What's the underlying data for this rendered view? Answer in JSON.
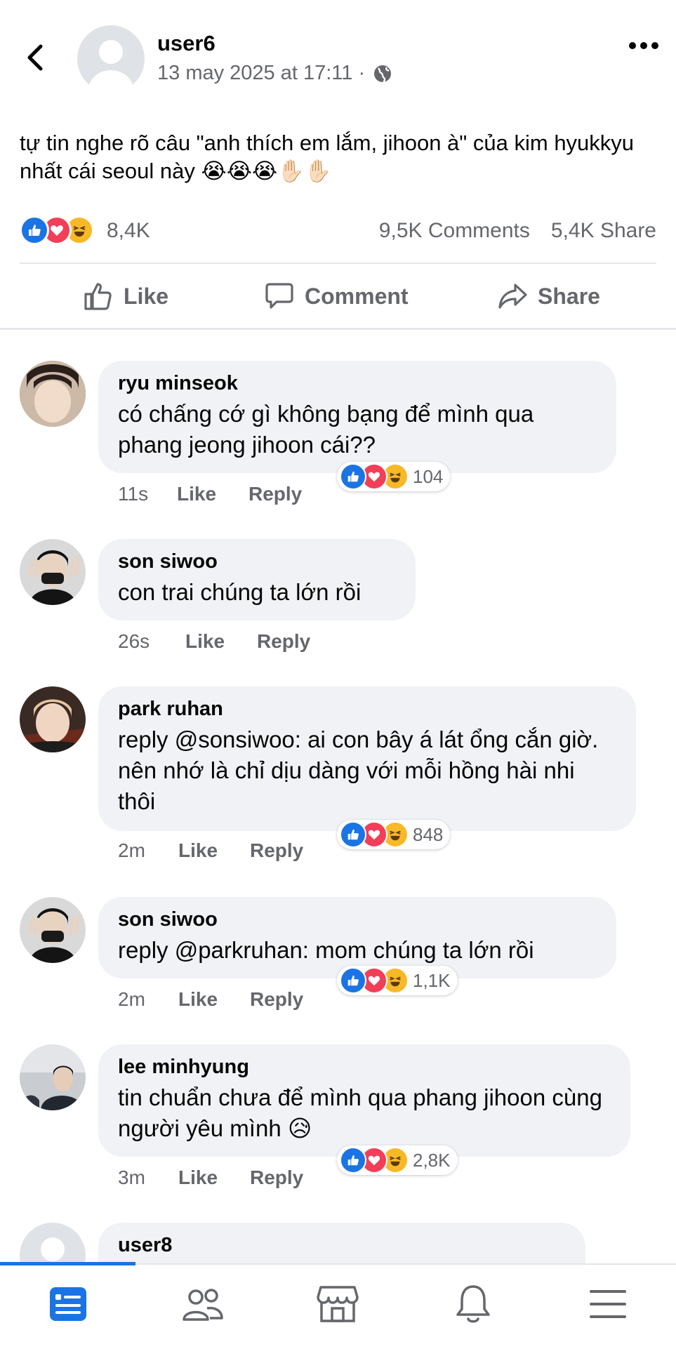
{
  "post": {
    "author": "user6",
    "timestamp": "13 may 2025 at 17:11 ·",
    "text": "tự tin nghe rõ câu \"anh thích em lắm, jihoon à\" của kim hyukkyu nhất cái seoul này 😭😭😭✋🏻✋🏻",
    "reaction_count": "8,4K",
    "comments_count": "9,5K Comments",
    "shares_count": "5,4K Share"
  },
  "actions": {
    "like": "Like",
    "comment": "Comment",
    "share": "Share"
  },
  "comments": [
    {
      "author": "ryu minseok",
      "text": "có chấng cớ gì không bạng để mình qua phang jeong jihoon cái??",
      "time": "11s",
      "like": "Like",
      "reply": "Reply",
      "reactions": "104"
    },
    {
      "author": "son siwoo",
      "text": "con trai chúng ta lớn rồi",
      "time": "26s",
      "like": "Like",
      "reply": "Reply"
    },
    {
      "author": "park ruhan",
      "text": "reply @sonsiwoo: ai con bây á lát ổng cắn giờ. nên nhớ là chỉ dịu dàng với mỗi hồng hài nhi thôi",
      "time": "2m",
      "like": "Like",
      "reply": "Reply",
      "reactions": "848"
    },
    {
      "author": "son siwoo",
      "text": "reply @parkruhan: mom chúng ta lớn rồi",
      "time": "2m",
      "like": "Like",
      "reply": "Reply",
      "reactions": "1,1K"
    },
    {
      "author": "lee minhyung",
      "text": "tin chuẩn chưa để mình qua phang jihoon cùng người yêu mình 😥",
      "time": "3m",
      "like": "Like",
      "reply": "Reply",
      "reactions": "2,8K"
    },
    {
      "author": "user8"
    }
  ],
  "colors": {
    "like_blue": "#1b74e4",
    "love_red": "#f33e58",
    "haha_yellow": "#f7b928",
    "secondary_text": "#65676b",
    "bubble_bg": "#f0f2f5"
  },
  "icons": [
    "back-icon",
    "more-icon",
    "globe-icon",
    "like-icon",
    "comment-icon",
    "share-icon",
    "feed-icon",
    "friends-icon",
    "marketplace-icon",
    "notifications-icon",
    "menu-icon"
  ]
}
